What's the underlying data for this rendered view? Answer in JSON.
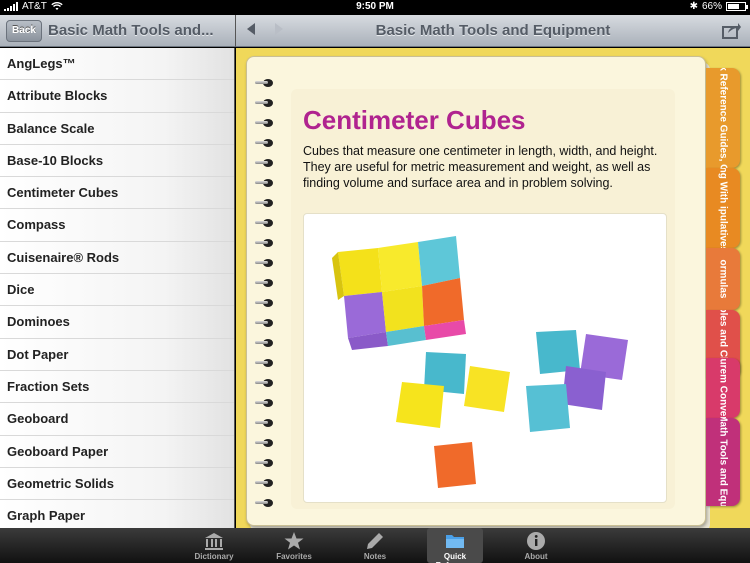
{
  "status_bar": {
    "carrier": "AT&T",
    "time": "9:50 PM",
    "battery": "66%",
    "battery_level": 0.66
  },
  "sidebar": {
    "back_label": "Back",
    "title": "Basic Math Tools and...",
    "items": [
      {
        "label": "AngLegs™"
      },
      {
        "label": "Attribute Blocks"
      },
      {
        "label": "Balance Scale"
      },
      {
        "label": "Base-10 Blocks"
      },
      {
        "label": "Centimeter Cubes"
      },
      {
        "label": "Compass"
      },
      {
        "label": "Cuisenaire® Rods"
      },
      {
        "label": "Dice"
      },
      {
        "label": "Dominoes"
      },
      {
        "label": "Dot Paper"
      },
      {
        "label": "Fraction Sets"
      },
      {
        "label": "Geoboard"
      },
      {
        "label": "Geoboard Paper"
      },
      {
        "label": "Geometric Solids"
      },
      {
        "label": "Graph Paper"
      }
    ]
  },
  "header": {
    "title": "Basic Math Tools and Equipment",
    "icons": [
      "back-arrow-icon",
      "forward-arrow-icon",
      "share-icon"
    ]
  },
  "main": {
    "title": "Centimeter Cubes",
    "description": "Cubes that measure one centimeter in length, width, and height. They are useful for metric measurement and weight, as well as finding volume and surface area and in problem solving.",
    "image_alt": "photo of colored centimeter cubes",
    "tabs": [
      {
        "label": "Quick Reference Guides, Opera",
        "color": "#e89a2c"
      },
      {
        "label": "ing With ipulatives",
        "color": "#e88a22"
      },
      {
        "label": "ormulas",
        "color": "#e87a3a"
      },
      {
        "label": "bles and Charts",
        "color": "#e0504a"
      },
      {
        "label": "asurem Conversi",
        "color": "#d83a6a"
      },
      {
        "label": "Basic Math Tools and Equipment",
        "color": "#c0307a"
      }
    ]
  },
  "tabbar": {
    "items": [
      {
        "label": "Dictionary",
        "icon": "dictionary-icon"
      },
      {
        "label": "Favorites",
        "icon": "star-icon"
      },
      {
        "label": "Notes",
        "icon": "pencil-icon"
      },
      {
        "label": "Quick Reference",
        "icon": "folder-icon"
      },
      {
        "label": "About",
        "icon": "info-icon"
      }
    ],
    "active": "Quick Reference"
  }
}
